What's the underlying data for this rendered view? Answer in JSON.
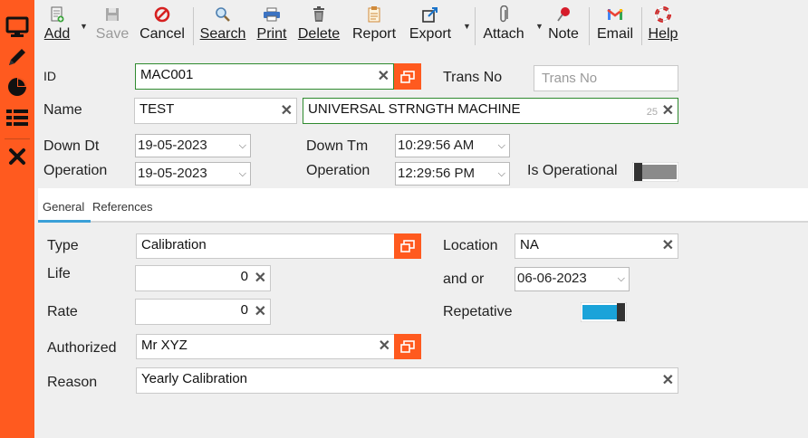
{
  "toolbar": {
    "add": "Add",
    "save": "Save",
    "cancel": "Cancel",
    "search": "Search",
    "print": "Print",
    "delete": "Delete",
    "report": "Report",
    "export": "Export",
    "attach": "Attach",
    "note": "Note",
    "email": "Email",
    "help": "Help"
  },
  "form": {
    "id_label": "ID",
    "id_value": "MAC001",
    "trans_no_label": "Trans No",
    "trans_no_placeholder": "Trans No",
    "name_label": "Name",
    "name_code": "TEST",
    "name_desc": "UNIVERSAL STRNGTH MACHINE",
    "name_counter": "25",
    "down_dt_label": "Down Dt",
    "down_dt": "19-05-2023",
    "down_tm_label": "Down Tm",
    "down_tm": "10:29:56 AM",
    "operation_label": "Operation",
    "operation_dt": "19-05-2023",
    "operation_tm_label": "Operation",
    "operation_tm": "12:29:56 PM",
    "is_operational_label": "Is Operational",
    "is_operational": false
  },
  "tabs": [
    {
      "label": "General",
      "active": true
    },
    {
      "label": "References",
      "active": false
    }
  ],
  "general": {
    "type_label": "Type",
    "type_value": "Calibration",
    "location_label": "Location",
    "location_value": "NA",
    "life_label": "Life",
    "life_value": "0",
    "and_or_label": "and or",
    "and_or_value": "06-06-2023",
    "rate_label": "Rate",
    "rate_value": "0",
    "repetative_label": "Repetative",
    "repetative": true,
    "authorized_label": "Authorized",
    "authorized_value": "Mr XYZ",
    "reason_label": "Reason",
    "reason_value": "Yearly Calibration"
  },
  "colors": {
    "accent": "#ff5a1f",
    "toggle_on": "#1aa3d9",
    "toggle_off": "#8a8a8a",
    "tab_active": "#3aa0d8",
    "valid_border": "#2f8a2f"
  },
  "sidebar_icons": [
    "monitor-icon",
    "pencil-icon",
    "pie-chart-icon",
    "list-icon",
    "close-icon"
  ]
}
